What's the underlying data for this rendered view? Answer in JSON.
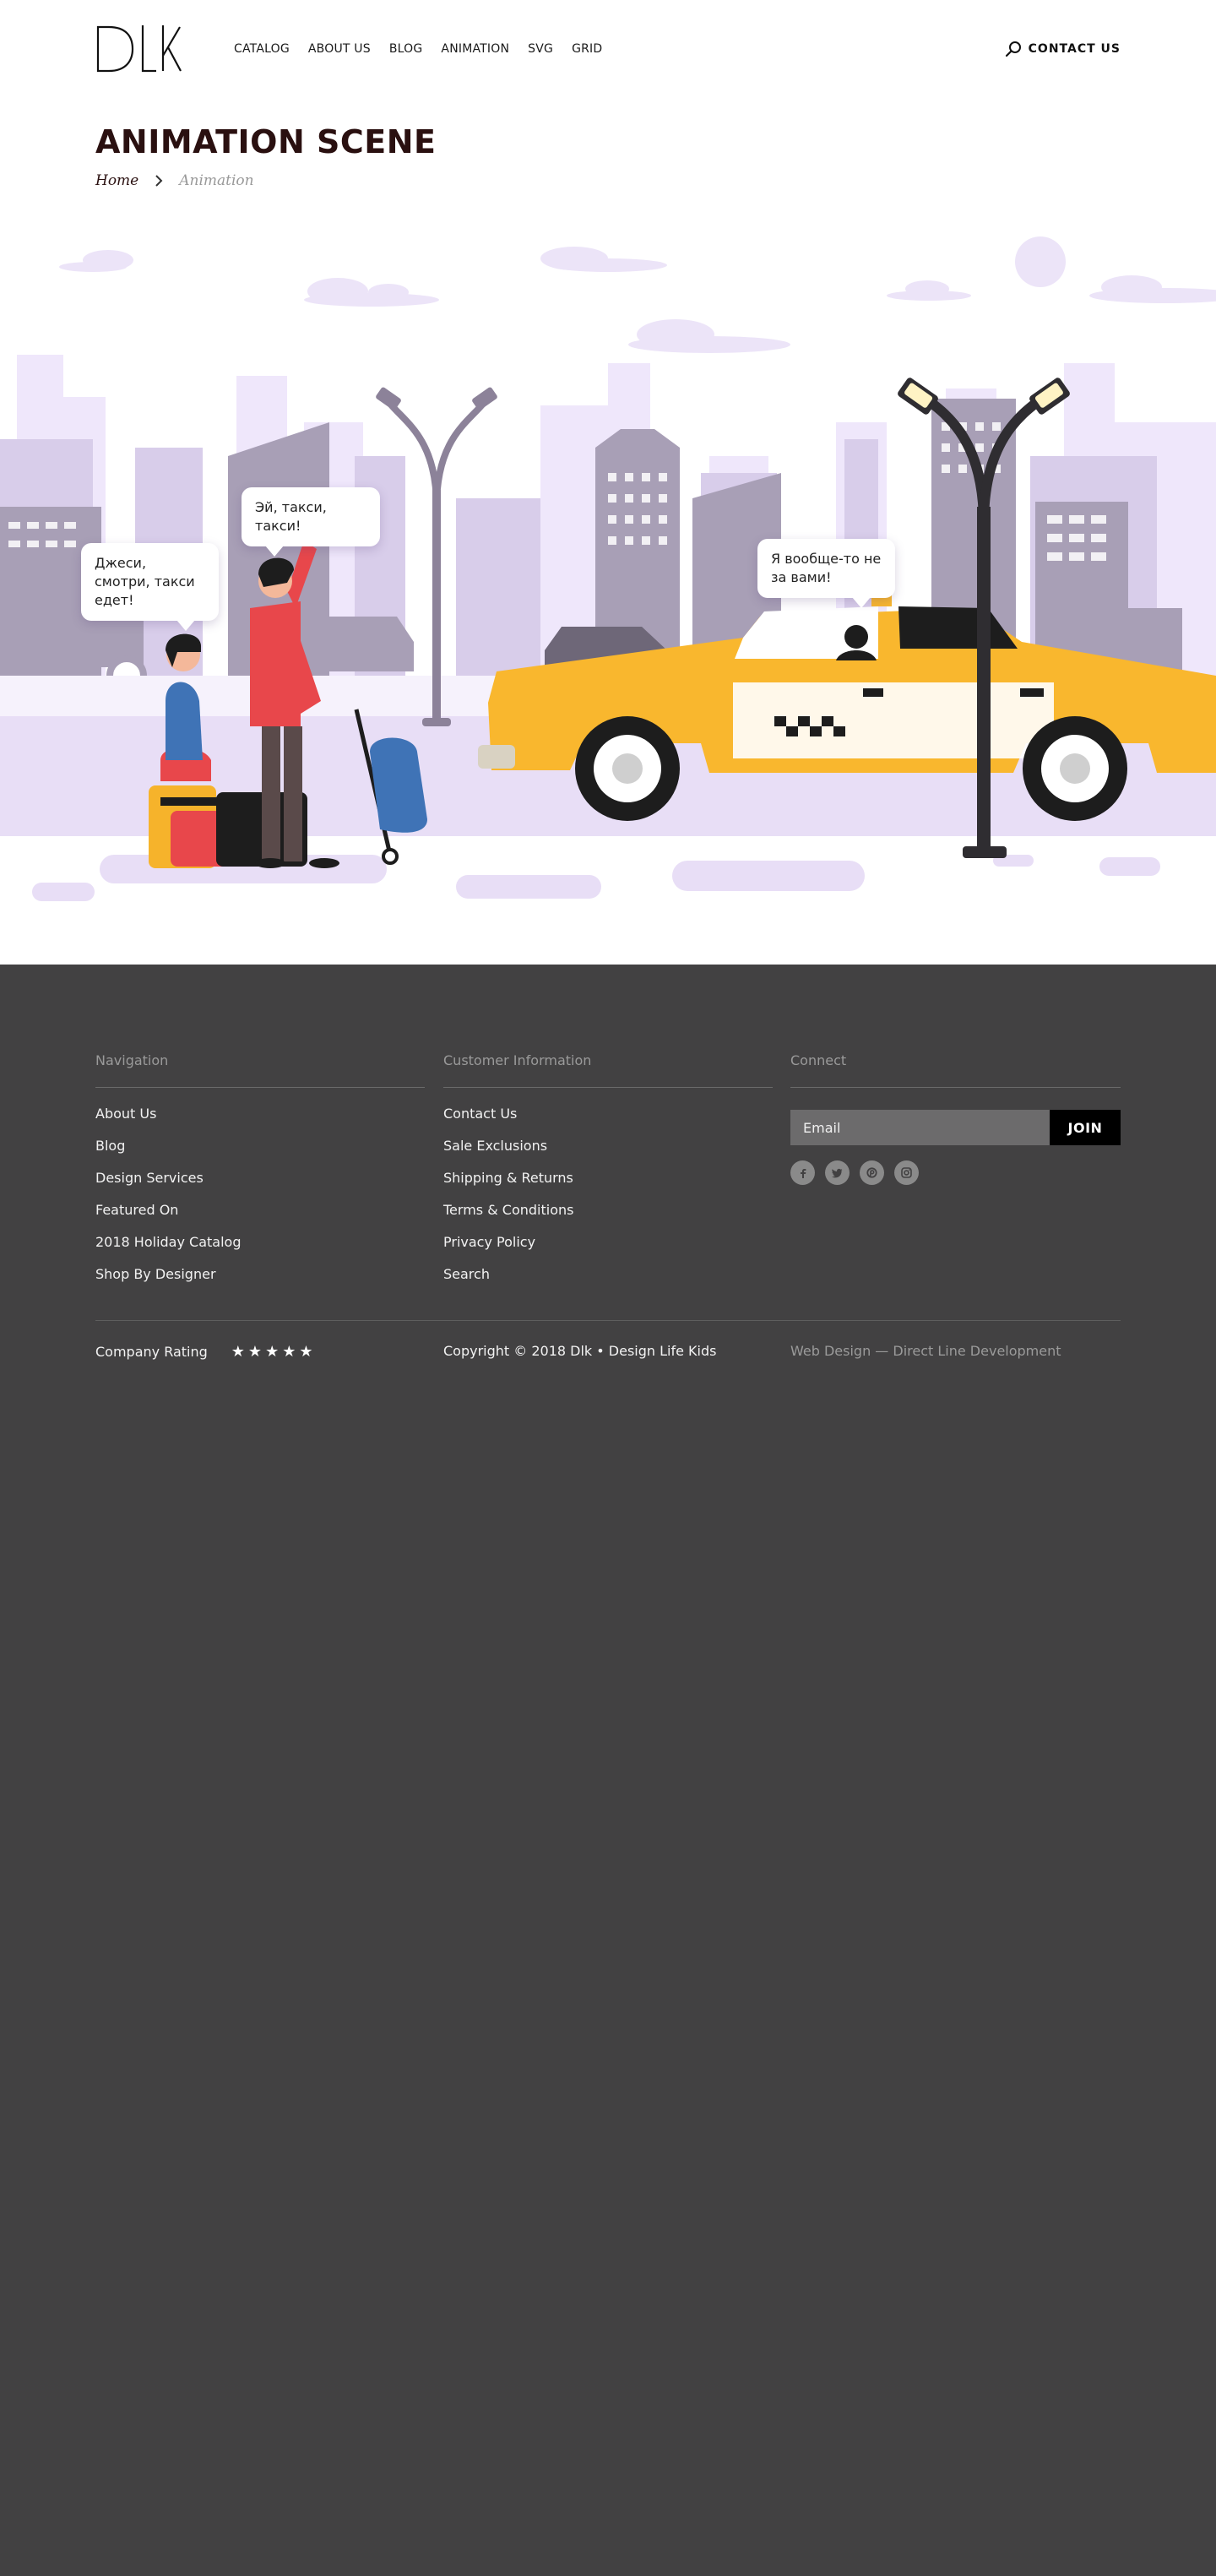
{
  "header": {
    "logo": "DLK",
    "nav": [
      "CATALOG",
      "ABOUT US",
      "BLOG",
      "ANIMATION",
      "SVG",
      "GRID"
    ],
    "contact": "CONTACT  US"
  },
  "page": {
    "title": "ANIMATION SCENE",
    "breadcrumb": {
      "home": "Home",
      "current": "Animation"
    }
  },
  "scene": {
    "bubbles": [
      "Джеси, смотри, такси едет!",
      "Эй, такси, такси!",
      "Я вообще-то не за вами!"
    ]
  },
  "footer": {
    "columns": [
      {
        "title": "Navigation",
        "items": [
          "About Us",
          "Blog",
          "Design Services",
          "Featured On",
          "2018 Holiday Catalog",
          "Shop By Designer"
        ]
      },
      {
        "title": "Customer Information",
        "items": [
          "Contact Us",
          "Sale Exclusions",
          "Shipping & Returns",
          "Terms & Conditions",
          "Privacy Policy",
          "Search"
        ]
      }
    ],
    "connect": {
      "title": "Connect",
      "email_placeholder": "Email",
      "join": "JOIN",
      "socials": [
        "facebook-icon",
        "twitter-icon",
        "pinterest-icon",
        "instagram-icon"
      ]
    },
    "rating": {
      "label": "Company Rating",
      "stars": "★★★★★"
    },
    "copyright": "Copyright © 2018 Dlk • Design Life Kids",
    "credit": "Web Design — Direct Line Development"
  },
  "colors": {
    "taxi": "#f9b72e",
    "coat": "#e8474b",
    "city": "#a89fb6",
    "footer": "#424142"
  }
}
